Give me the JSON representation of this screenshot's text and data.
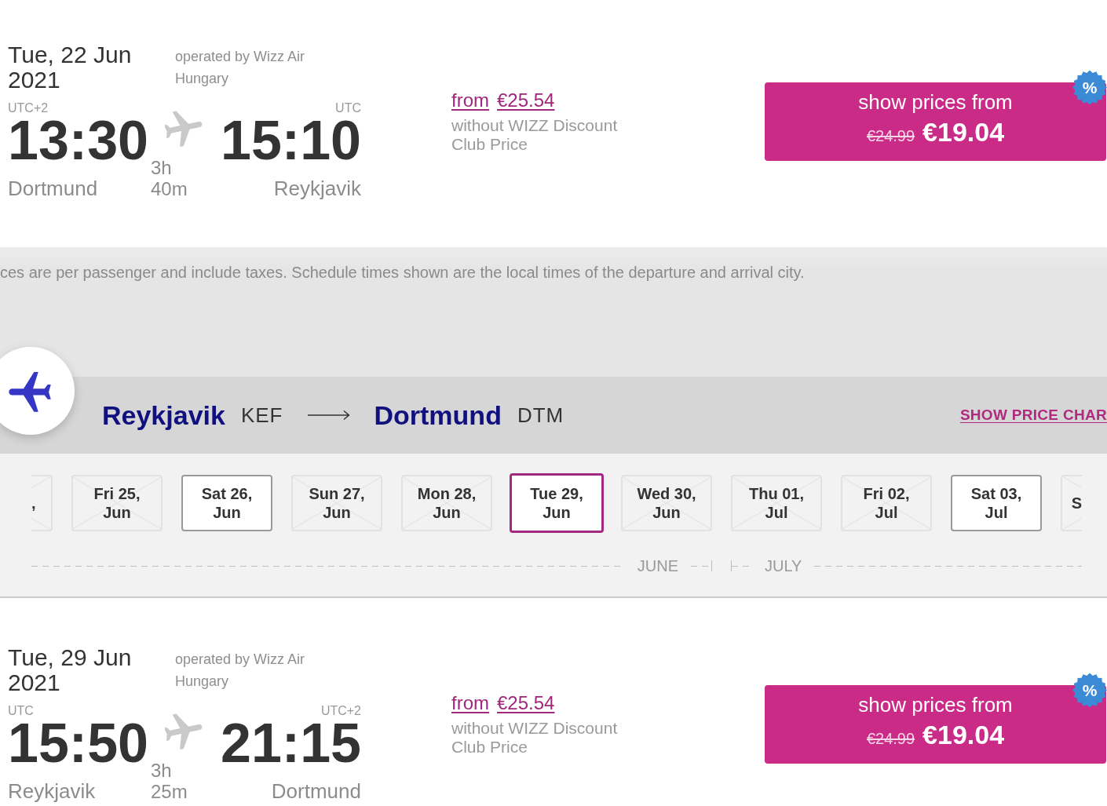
{
  "outbound_flight": {
    "date": "Tue, 22 Jun 2021",
    "operator": "operated by Wizz Air Hungary",
    "departure": {
      "timezone": "UTC+2",
      "time": "13:30",
      "city": "Dortmund"
    },
    "duration": "3h 40m",
    "arrival": {
      "timezone": "UTC",
      "time": "15:10",
      "city": "Reykjavik"
    },
    "fare": {
      "from_label": "from",
      "price": "€25.54",
      "note": "without WIZZ Discount Club Price"
    },
    "price_button": {
      "label": "show prices from",
      "old_price": "€24.99",
      "price": "€19.04",
      "badge": "%"
    }
  },
  "notice": "ces are per passenger and include taxes. Schedule times shown are the local times of the departure and arrival city.",
  "return_route": {
    "origin": {
      "city": "Reykjavik",
      "code": "KEF"
    },
    "destination": {
      "city": "Dortmund",
      "code": "DTM"
    },
    "price_chart_link": "SHOW PRICE CHAR",
    "months": [
      {
        "label": "JUNE",
        "days": [
          {
            "day": ",",
            "available": false,
            "selected": false
          },
          {
            "day": "Fri 25,",
            "month": "Jun",
            "available": false,
            "selected": false
          },
          {
            "day": "Sat 26,",
            "month": "Jun",
            "available": true,
            "selected": false
          },
          {
            "day": "Sun 27,",
            "month": "Jun",
            "available": false,
            "selected": false
          },
          {
            "day": "Mon 28,",
            "month": "Jun",
            "available": false,
            "selected": false
          },
          {
            "day": "Tue 29,",
            "month": "Jun",
            "available": true,
            "selected": true
          },
          {
            "day": "Wed 30,",
            "month": "Jun",
            "available": false,
            "selected": false
          }
        ]
      },
      {
        "label": "JULY",
        "days": [
          {
            "day": "Thu 01,",
            "month": "Jul",
            "available": false,
            "selected": false
          },
          {
            "day": "Fri 02,",
            "month": "Jul",
            "available": false,
            "selected": false
          },
          {
            "day": "Sat 03,",
            "month": "Jul",
            "available": true,
            "selected": false
          },
          {
            "day": "S",
            "available": false,
            "selected": false
          }
        ]
      }
    ]
  },
  "return_flight": {
    "date": "Tue, 29 Jun 2021",
    "operator": "operated by Wizz Air Hungary",
    "departure": {
      "timezone": "UTC",
      "time": "15:50",
      "city": "Reykjavik"
    },
    "duration": "3h 25m",
    "arrival": {
      "timezone": "UTC+2",
      "time": "21:15",
      "city": "Dortmund"
    },
    "fare": {
      "from_label": "from",
      "price": "€25.54",
      "note": "without WIZZ Discount Club Price"
    },
    "price_button": {
      "label": "show prices from",
      "old_price": "€24.99",
      "price": "€19.04",
      "badge": "%"
    }
  }
}
